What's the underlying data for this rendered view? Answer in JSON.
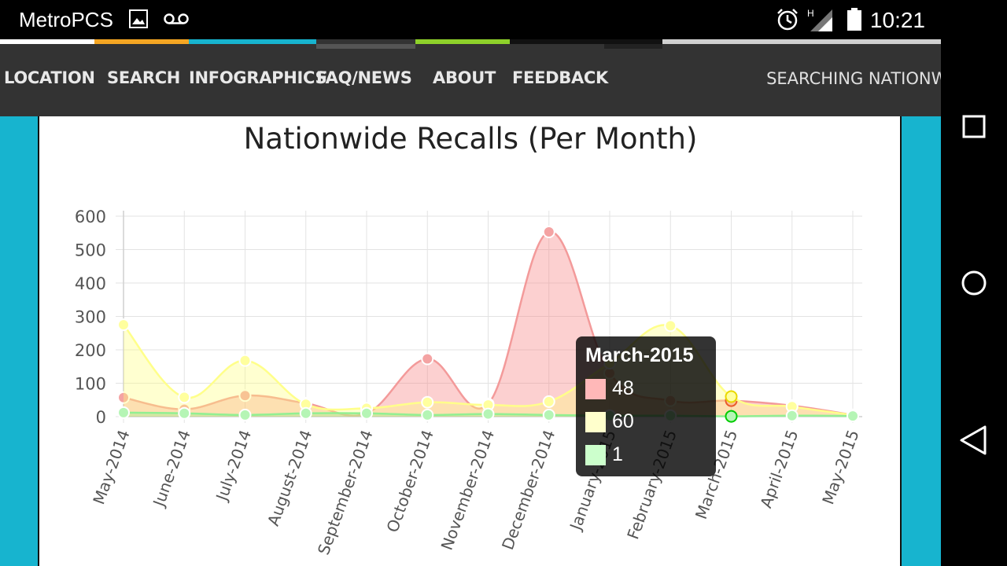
{
  "statusbar": {
    "carrier": "MetroPCS",
    "time": "10:21",
    "icons": [
      "image-icon",
      "voicemail-icon",
      "alarm-icon",
      "signal-icon",
      "battery-icon"
    ]
  },
  "nav": {
    "items": [
      "LOCATION",
      "SEARCH",
      "INFOGRAPHICS",
      "FAQ/NEWS",
      "ABOUT",
      "FEEDBACK"
    ],
    "status": "SEARCHING NATIONWIDE"
  },
  "colors": {
    "page_bg": "#17b4cf",
    "series1": "#f7a9a9",
    "series2": "#ffff9e",
    "series3": "#b5f5b5"
  },
  "chart_data": {
    "type": "area",
    "title": "Nationwide Recalls (Per Month)",
    "categories": [
      "May-2014",
      "June-2014",
      "July-2014",
      "August-2014",
      "September-2014",
      "October-2014",
      "November-2014",
      "December-2014",
      "January-2015",
      "February-2015",
      "March-2015",
      "April-2015",
      "May-2015"
    ],
    "y_ticks": [
      "600",
      "500",
      "400",
      "300",
      "200",
      "100",
      "0"
    ],
    "ylim": [
      0,
      600
    ],
    "grid": true,
    "series": [
      {
        "values": [
          57,
          22,
          63,
          40,
          10,
          173,
          38,
          553,
          130,
          48,
          48,
          33,
          5
        ]
      },
      {
        "values": [
          275,
          58,
          168,
          37,
          25,
          43,
          35,
          45,
          160,
          272,
          60,
          30,
          5
        ]
      },
      {
        "values": [
          12,
          10,
          5,
          10,
          10,
          5,
          8,
          5,
          3,
          3,
          1,
          3,
          2
        ]
      }
    ],
    "tooltip": {
      "title": "March-2015",
      "values": [
        "48",
        "60",
        "1"
      ]
    }
  },
  "system_nav": [
    "recents-icon",
    "home-icon",
    "back-icon"
  ]
}
